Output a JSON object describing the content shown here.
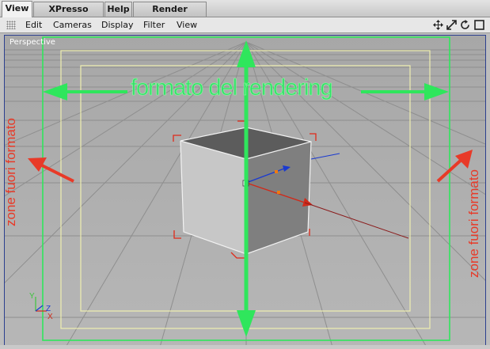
{
  "tabs": [
    {
      "label": "View",
      "active": true
    },
    {
      "label": "XPresso Editor",
      "active": false
    },
    {
      "label": "Help",
      "active": false
    },
    {
      "label": "Render Settings",
      "active": false
    }
  ],
  "menu": [
    "Edit",
    "Cameras",
    "Display",
    "Filter",
    "View"
  ],
  "nav_icons": [
    "move-view-icon",
    "zoom-view-icon",
    "rotate-view-icon",
    "maximize-view-icon"
  ],
  "viewport": {
    "label": "Perspective",
    "axis_labels": {
      "y": "Y",
      "z": "Z",
      "x": "X"
    }
  },
  "annotations": {
    "render_frame": "formato del rendering",
    "outside_left": "zone fuori formato",
    "outside_right": "zone fuori formato"
  },
  "colors": {
    "annotation_green": "#2fe65c",
    "annotation_red": "#e83a28",
    "safe_frame": "#efefb0",
    "viewport_border": "#2b3f8f"
  }
}
